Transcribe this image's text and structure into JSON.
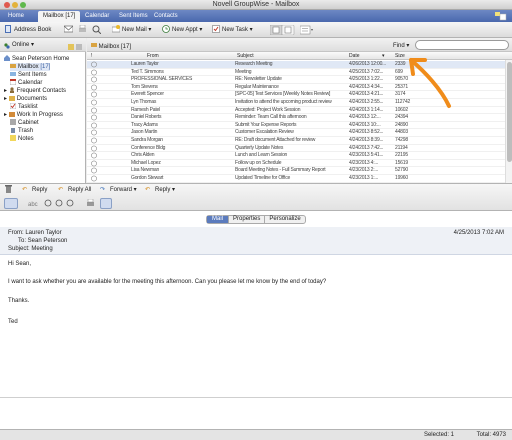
{
  "window": {
    "title": "Novell GroupWise - Mailbox"
  },
  "main_tabs": [
    "Home",
    "Mailbox [17]",
    "Calendar",
    "Sent Items",
    "Contacts"
  ],
  "toolbar": {
    "address_book": "Address Book",
    "new_mail": "New Mail",
    "new_appt": "New Appt",
    "new_task": "New Task"
  },
  "sidebar": {
    "status": "Online",
    "items": [
      {
        "label": "Sean Peterson Home",
        "icon": "home-icon"
      },
      {
        "label": "Mailbox",
        "count": "[17]",
        "icon": "mailbox-icon"
      },
      {
        "label": "Sent Items",
        "icon": "sent-icon"
      },
      {
        "label": "Calendar",
        "icon": "calendar-icon"
      },
      {
        "label": "Frequent Contacts",
        "icon": "contacts-icon"
      },
      {
        "label": "Documents",
        "icon": "documents-icon"
      },
      {
        "label": "Tasklist",
        "icon": "tasklist-icon"
      },
      {
        "label": "Work In Progress",
        "icon": "work-icon"
      },
      {
        "label": "Cabinet",
        "icon": "cabinet-icon"
      },
      {
        "label": "Trash",
        "icon": "trash-icon"
      },
      {
        "label": "Notes",
        "icon": "notes-icon"
      }
    ]
  },
  "mailbox": {
    "breadcrumb": "Mailbox [17]",
    "find_label": "Find",
    "columns": {
      "from": "From",
      "subject": "Subject",
      "date": "Date",
      "size": "Size"
    },
    "rows": [
      {
        "from": "Lauren Taylor",
        "subject": "Research Meeting",
        "date": "4/26/2013 12:00...",
        "size": "2339"
      },
      {
        "from": "Ted T. Simmons",
        "subject": "Meeting",
        "date": "4/25/2013 7:02...",
        "size": "699"
      },
      {
        "from": "PROFESSIONAL SERVICES",
        "subject": "RE: Newsletter Update",
        "date": "4/25/2013 1:22...",
        "size": "90570"
      },
      {
        "from": "Tom Stevens",
        "subject": "Regular Maintenance",
        "date": "4/24/2013 4:34...",
        "size": "25371"
      },
      {
        "from": "Everett Spencer",
        "subject": "[SPC-05] Test Services [Weekly Notes Review]",
        "date": "4/24/2013 4:21...",
        "size": "3174"
      },
      {
        "from": "Lyn Thomas",
        "subject": "Invitation to attend the upcoming product review",
        "date": "4/24/2013 2:55...",
        "size": "112742"
      },
      {
        "from": "Ramesh Patel",
        "subject": "Accepted: Project Work Session",
        "date": "4/24/2013 1:14...",
        "size": "10602"
      },
      {
        "from": "Daniel Roberts",
        "subject": "Reminder: Team Call this afternoon",
        "date": "4/24/2013 12:...",
        "size": "24394"
      },
      {
        "from": "Tracy Adams",
        "subject": "Submit Your Expense Reports",
        "date": "4/24/2013 10:...",
        "size": "24890"
      },
      {
        "from": "Jason Martin",
        "subject": "Customer Escalation Review",
        "date": "4/24/2013 8:52...",
        "size": "44803"
      },
      {
        "from": "Sandra Morgan",
        "subject": "RE: Draft document Attached for review",
        "date": "4/24/2013 8:39...",
        "size": "74298"
      },
      {
        "from": "Conference Bldg",
        "subject": "Quarterly Update Notes",
        "date": "4/24/2013 7:42...",
        "size": "21194"
      },
      {
        "from": "Chris Alden",
        "subject": "Lunch and Learn Session",
        "date": "4/23/2013 5:41...",
        "size": "22195"
      },
      {
        "from": "Michael Lopez",
        "subject": "Follow up on Schedule",
        "date": "4/23/2013 4:...",
        "size": "15619"
      },
      {
        "from": "Lisa Newman",
        "subject": "Board Meeting Notes - Full Summary Report",
        "date": "4/23/2013 2:...",
        "size": "52790"
      },
      {
        "from": "Gordon Stewart",
        "subject": "Updated Timeline for Office",
        "date": "4/23/2013 1:...",
        "size": "19960"
      }
    ]
  },
  "reading_toolbar": {
    "reply": "Reply",
    "reply_all": "Reply All",
    "forward": "Forward",
    "reply2": "Reply"
  },
  "reader": {
    "tabs": [
      "Mail",
      "Properties",
      "Personalize"
    ],
    "from": "From: Lauren Taylor",
    "to": "To: Sean Peterson",
    "subject": "Subject: Meeting",
    "date": "4/25/2013 7:02 AM",
    "body": [
      "Hi Sean,",
      "I want to ask whether you are available for the meeting this afternoon. Can you please let me know by the end of today?",
      "Thanks.",
      "Ted"
    ]
  },
  "status": {
    "selected": "Selected: 1",
    "total": "Total: 4973"
  }
}
